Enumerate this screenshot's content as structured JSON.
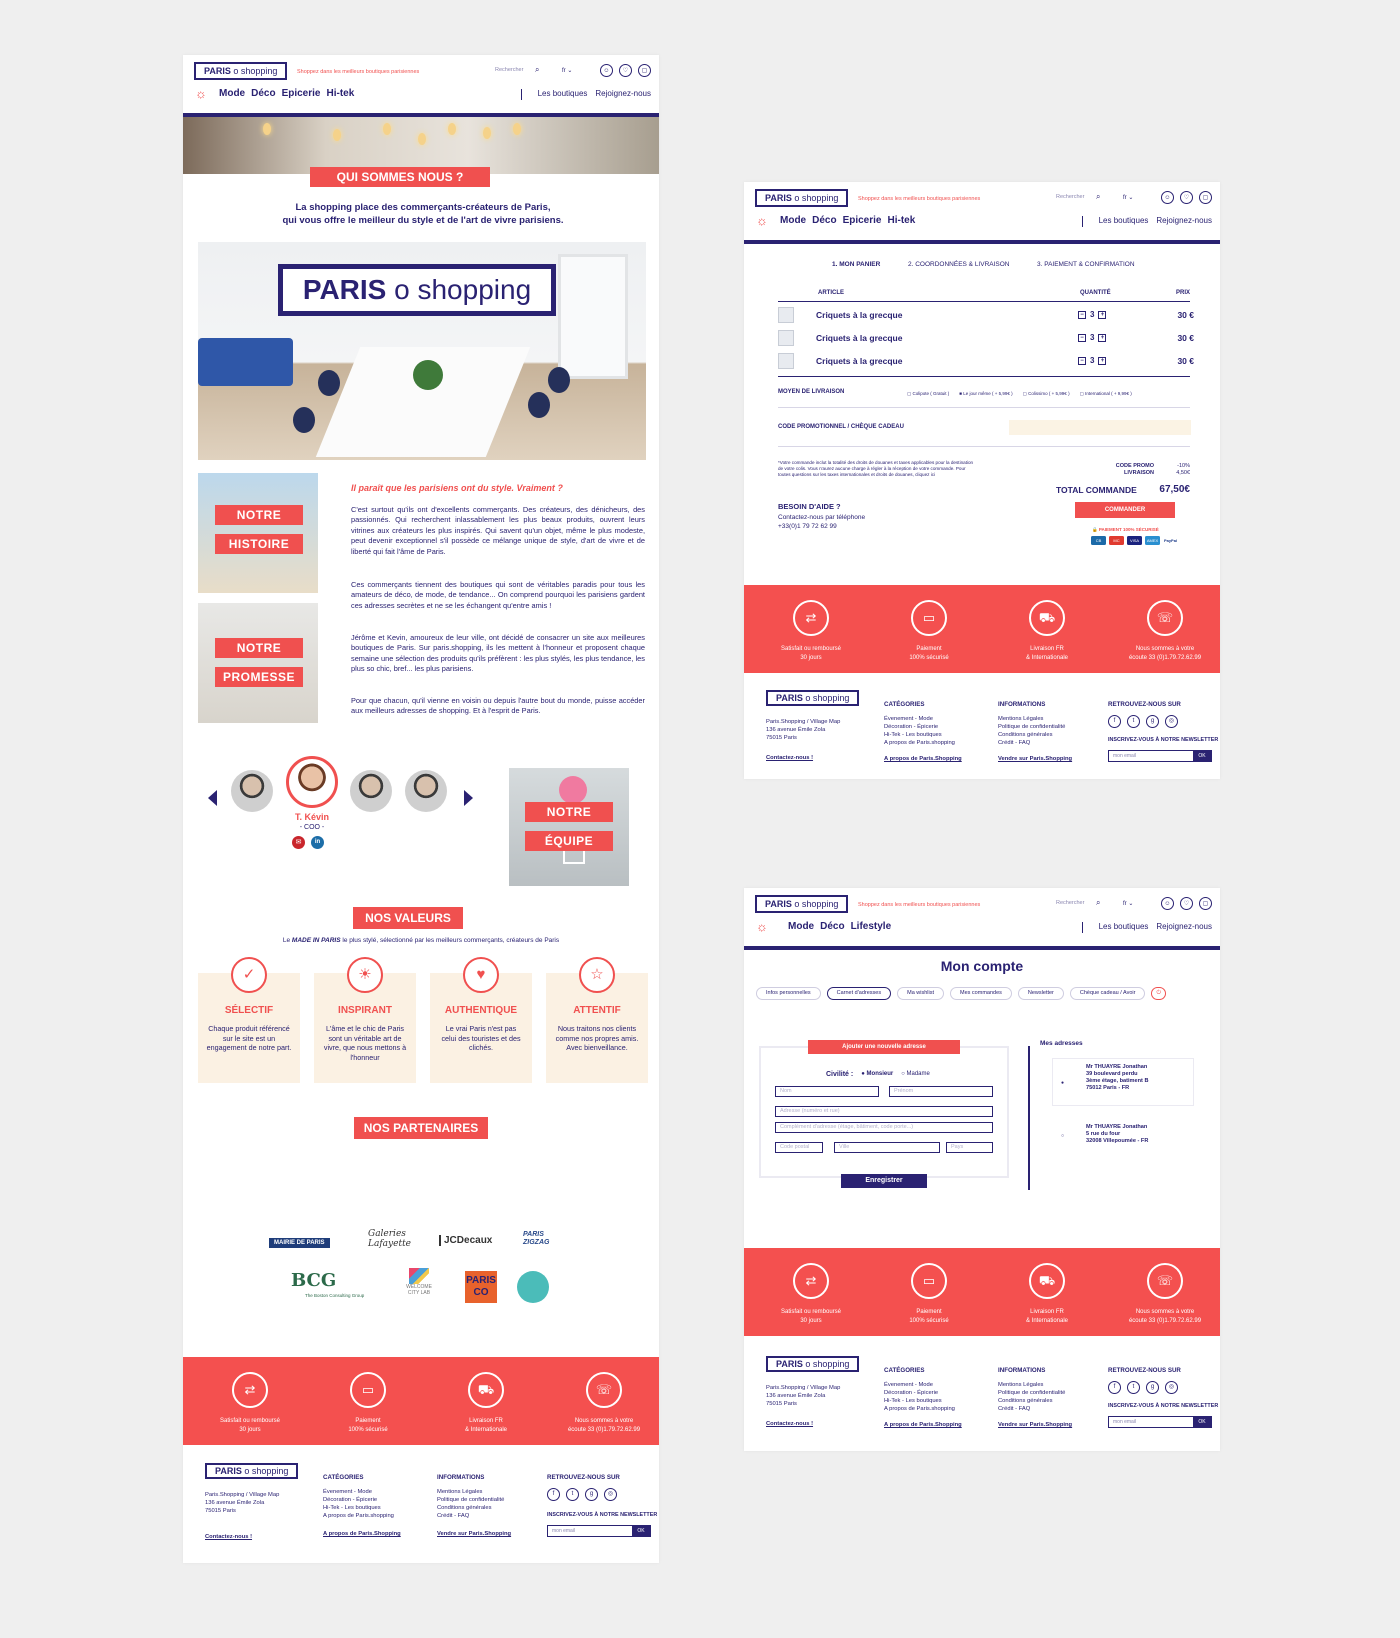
{
  "header": {
    "logo_main": "PARIS",
    "logo_dot": "o",
    "logo_sub": "shopping",
    "tagline": "Shoppez dans les meilleurs boutiques parisiennes",
    "search_label": "Rechercher",
    "search_icon": "search-icon",
    "lang": "fr ⌄",
    "user_icon": "user-icon",
    "wishlist_icon": "heart-icon",
    "cart_icon": "bag-icon",
    "sun_icon": "sun-icon",
    "nav": [
      "Mode",
      "Déco",
      "Epicerie",
      "Hi-tek"
    ],
    "nav_account": [
      "Mode",
      "Déco",
      "Lifestyle"
    ],
    "nav_right": [
      "Les boutiques",
      "Rejoignez-nous"
    ]
  },
  "about": {
    "title": "QUI SOMMES NOUS ?",
    "intro_line1": "La shopping place des commerçants-créateurs de Paris,",
    "intro_line2": "qui vous offre le meilleur du style et de l'art de vivre parisiens.",
    "hero_logo_main": "PARIS",
    "hero_logo_dot": "o",
    "hero_logo_sub": "shopping",
    "histoire_1": "NOTRE",
    "histoire_2": "HISTOIRE",
    "promesse_1": "NOTRE",
    "promesse_2": "PROMESSE",
    "quote": "Il paraît que les parisiens ont du style. Vraiment ?",
    "p1": "C'est surtout qu'ils ont d'excellents commerçants. Des créateurs, des dénicheurs, des passionnés. Qui recherchent inlassablement les plus beaux produits, ouvrent leurs vitrines aux créateurs les plus inspirés. Qui savent qu'un objet, même le plus modeste, peut devenir exceptionnel s'il possède ce mélange unique de style, d'art de vivre et de liberté qui fait l'âme de Paris.",
    "p2": "Ces commerçants tiennent des boutiques qui sont de véritables paradis pour tous les amateurs de déco, de mode, de tendance... On comprend pourquoi les parisiens gardent ces adresses secrètes et ne se les échangent qu'entre amis !",
    "p3": "Jérôme et Kevin, amoureux de leur ville, ont décidé de consacrer un site aux meilleures boutiques de Paris. Sur paris.shopping, ils les mettent à l'honneur et proposent chaque semaine une sélection des produits qu'ils préfèrent : les plus stylés, les plus tendance, les plus so chic, bref... les plus parisiens.",
    "p4": "Pour que chacun, qu'il vienne en voisin ou depuis l'autre bout du monde, puisse accéder aux meilleurs adresses de shopping. Et à l'esprit de Paris."
  },
  "team": {
    "name": "T. Kévin",
    "role": "- COO -",
    "mail_icon": "mail-icon",
    "linkedin_icon": "linkedin-icon",
    "prev_icon": "arrow-left-icon",
    "next_icon": "arrow-right-icon",
    "label_1": "NOTRE",
    "label_2": "ÉQUIPE"
  },
  "values": {
    "title": "NOS VALEURS",
    "sub_pre": "Le ",
    "sub_em": "MADE IN PARIS",
    "sub_post": " le plus stylé, sélectionné par les meilleurs commerçants, créateurs de Paris",
    "items": [
      {
        "icon": "check-icon",
        "title": "SÉLECTIF",
        "text": "Chaque produit référencé sur le site est un engagement de notre part."
      },
      {
        "icon": "bulb-icon",
        "title": "INSPIRANT",
        "text": "L'âme et le chic de Paris sont un véritable art de vivre, que nous mettons à l'honneur"
      },
      {
        "icon": "apple-icon",
        "title": "AUTHENTIQUE",
        "text": "Le vrai Paris n'est pas celui des touristes et des clichés."
      },
      {
        "icon": "star-icon",
        "title": "ATTENTIF",
        "text": "Nous traitons nos clients comme nos propres amis. Avec bienveillance."
      }
    ]
  },
  "partners": {
    "title": "NOS PARTENAIRES",
    "logos": [
      "MAIRIE DE PARIS",
      "Galeries Lafayette",
      "JCDecaux",
      "PARIS ZIGZAG",
      "BCG",
      "The Boston Consulting Group",
      "WELCOME CITY LAB",
      "PARIS CO"
    ]
  },
  "reassurance": [
    {
      "icon": "exchange-icon",
      "l1": "Satisfait ou remboursé",
      "l2": "30 jours"
    },
    {
      "icon": "card-icon",
      "l1": "Paiement",
      "l2": "100% sécurisé"
    },
    {
      "icon": "truck-icon",
      "l1": "Livraison FR",
      "l2": "& Internationale"
    },
    {
      "icon": "headset-icon",
      "l1": "Nous sommes à votre",
      "l2": "écoute 33 (0)1.79.72.62.99"
    }
  ],
  "footer": {
    "addr1": "Paris.Shopping / Village Map",
    "addr2": "136 avenue Émile Zola",
    "addr3": "75015 Paris",
    "contact": "Contactez-nous !",
    "cat_title": "CATÉGORIES",
    "cat_items": [
      "Évenement - Mode",
      "Décoration - Épicerie",
      "Hi-Tek - Les boutiques",
      "A propos de Paris.shopping"
    ],
    "cat_link": "A propos de Paris.Shopping",
    "info_title": "INFORMATIONS",
    "info_items": [
      "Mentions Légales",
      "Politique de confidentialité",
      "Conditions générales",
      "Crédit - FAQ"
    ],
    "info_link": "Vendre sur Paris.Shopping",
    "social_title": "RETROUVEZ-NOUS SUR",
    "social": [
      "f",
      "t",
      "g",
      "◎"
    ],
    "nl_title": "INSCRIVEZ-VOUS À NOTRE NEWSLETTER",
    "nl_placeholder": "mon email",
    "nl_ok": "OK"
  },
  "cart": {
    "steps": [
      "1. MON PANIER",
      "2. COORDONNÉES & LIVRAISON",
      "3. PAIEMENT & CONFIRMATION"
    ],
    "col_article": "ARTICLE",
    "col_qty": "QUANTITÉ",
    "col_price": "PRIX",
    "items": [
      {
        "name": "Criquets à la grecque",
        "qty": "3",
        "price": "30 €"
      },
      {
        "name": "Criquets à la grecque",
        "qty": "3",
        "price": "30 €"
      },
      {
        "name": "Criquets à la grecque",
        "qty": "3",
        "price": "30 €"
      }
    ],
    "delivery_label": "MOYEN DE LIVRAISON",
    "delivery_opts": [
      "Colipote ( Gratuit )",
      "Le jour même ( + 5,99€ )",
      "Colissimo ( + 5,99€ )",
      "International ( + 9,99€ )"
    ],
    "promo_label": "CODE PROMOTIONNEL / CHÈQUE CADEAU",
    "note": "*Votre commande inclut la totalité des droits de douanes et taxes applicables pour la destination de votre colis. Vous n'aurez aucune charge à régler à la réception de votre commande. Pour toutes questions sur les taxes internationales et droits de douanes, cliquez ici",
    "promo_code_label": "CODE PROMO",
    "promo_code_val": "-10%",
    "shipping_label": "LIVRAISON",
    "shipping_val": "4,50€",
    "total_label": "TOTAL COMMANDE",
    "total_val": "67,50€",
    "help_title": "BESOIN D'AIDE ?",
    "help_1": "Contactez-nous par téléphone",
    "help_2": "+33(0)1 79 72 62 99",
    "order_btn": "COMMANDER",
    "secure": "PAIEMENT 100% SÉCURISÉ",
    "cards": [
      "CB",
      "MC",
      "VISA",
      "AMEX",
      "PayPal"
    ]
  },
  "account": {
    "title": "Mon compte",
    "tabs": [
      "Infos personnelles",
      "Carnet d'adresses",
      "Ma wishlist",
      "Mes commandes",
      "Newsletter",
      "Chèque cadeau / Avoir"
    ],
    "add_title": "Ajouter une nouvelle adresse",
    "civ_label": "Civilité :",
    "civ_opts": [
      "Monsieur",
      "Madame"
    ],
    "fields": [
      "Nom",
      "Prénom",
      "Adresse (numéro et rue)",
      "Complément d'adresse (étage, bâtiment, code porte...)",
      "Code postal",
      "Ville",
      "Pays"
    ],
    "save_btn": "Enregistrer",
    "my_addr": "Mes adresses",
    "addr1": [
      "Mr THUAYRE Jonathan",
      "39 boulevard perdu",
      "3ème étage, batiment B",
      "75012 Paris - FR"
    ],
    "addr2": [
      "Mr THUAYRE Jonathan",
      "5 rue du four",
      "32008 Villepoumée - FR"
    ]
  },
  "colors": {
    "accent": "#f0504f",
    "brand": "#2a2272",
    "cream": "#fbf1e3"
  }
}
